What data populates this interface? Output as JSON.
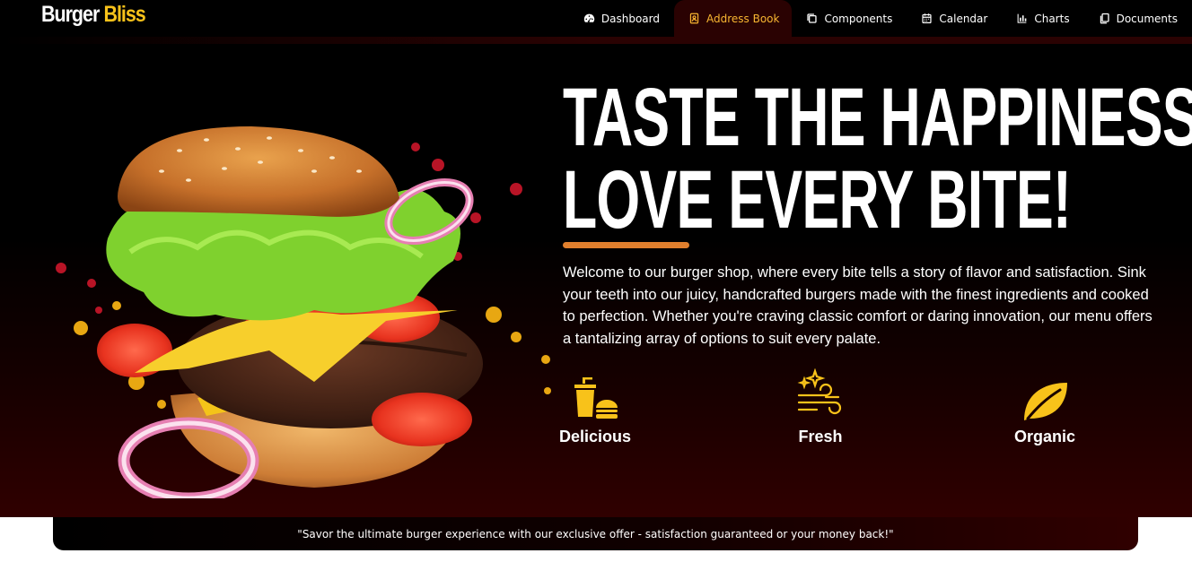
{
  "brand": {
    "part1": "Burger",
    "part2": "Bliss"
  },
  "nav": {
    "items": [
      {
        "label": "Dashboard",
        "icon": "gauge-icon",
        "active": false
      },
      {
        "label": "Address Book",
        "icon": "address-book-icon",
        "active": true
      },
      {
        "label": "Components",
        "icon": "copy-icon",
        "active": false
      },
      {
        "label": "Calendar",
        "icon": "calendar-icon",
        "active": false
      },
      {
        "label": "Charts",
        "icon": "bar-chart-icon",
        "active": false
      },
      {
        "label": "Documents",
        "icon": "documents-icon",
        "active": false
      }
    ]
  },
  "hero": {
    "headline_line1": "TASTE THE HAPPINESS,",
    "headline_line2": "LOVE EVERY BITE!",
    "description": "Welcome to our burger shop, where every bite tells a story of flavor and satisfaction. Sink your teeth into our juicy, handcrafted burgers made with the finest ingredients and cooked to perfection. Whether you're craving classic comfort or daring innovation, our menu offers a tantalizing array of options to suit every palate.",
    "features": [
      {
        "label": "Delicious",
        "icon": "fast-food-icon"
      },
      {
        "label": "Fresh",
        "icon": "sparkles-wind-icon"
      },
      {
        "label": "Organic",
        "icon": "leaf-icon"
      }
    ]
  },
  "banner": {
    "text": "\"Savor the ultimate burger experience with our exclusive offer - satisfaction guaranteed or your money back!\""
  },
  "colors": {
    "accent": "#f8c21a",
    "active_nav": "#f7b531",
    "bar": "#e07f2d",
    "hero_bottom": "#300000"
  }
}
